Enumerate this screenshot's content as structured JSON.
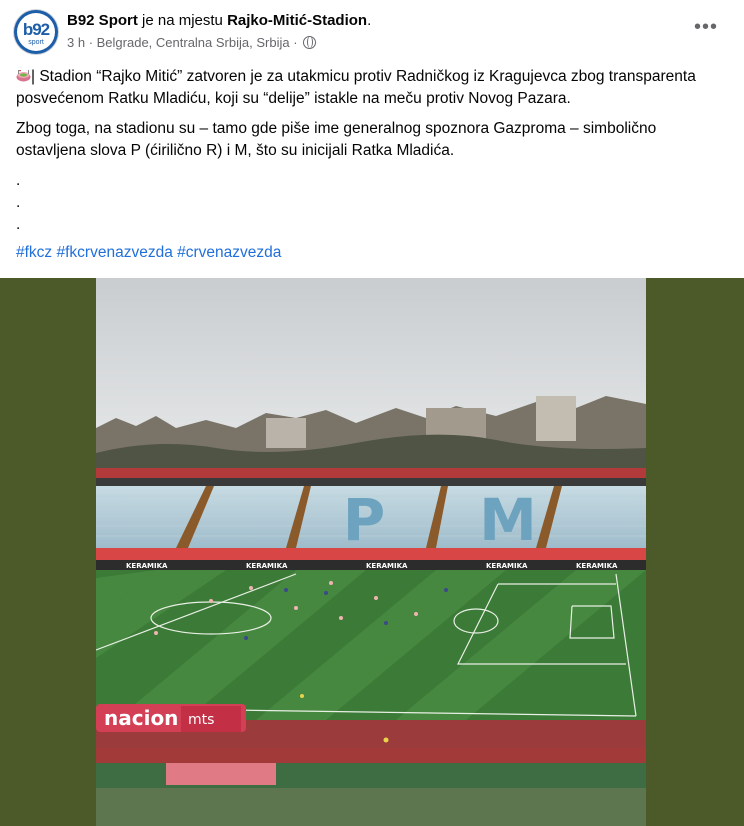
{
  "header": {
    "page_name": "B92 Sport",
    "action_text": " je na mjestu ",
    "location_name": "Rajko-Mitić-Stadion",
    "location_suffix": ".",
    "time": "3 h",
    "separator": " · ",
    "place": "Belgrade, Centralna Srbija, Srbija",
    "separator2": " · ",
    "privacy_icon": "globe-icon",
    "avatar": {
      "text": "b92",
      "subtext": "sport"
    },
    "more_label": "•••"
  },
  "post": {
    "paragraph1": "| Stadion “Rajko Mitić” zatvoren je za utakmicu protiv Radničkog iz Kragujevca zbog transparenta posvećenom Ratku Mladiću, koji su “delije” istakle na meču protiv Novog Pazara.",
    "paragraph2": "Zbog toga, na stadionu su – tamo gde piše ime generalnog spoznora Gazproma – simbolično ostavljena slova P (ćirilično R) i M, što su inicijali Ratka Mladića.",
    "dots": [
      ".",
      ".",
      "."
    ],
    "hashtags": [
      "#fkcz",
      "#fkcrvenazvezda",
      "#crvenazvezda"
    ],
    "emoji_icon": "stadium-icon"
  },
  "image": {
    "letters": [
      "P",
      "M"
    ],
    "sponsor_text": "KERAMIKA",
    "adboard_left": "nacion",
    "adboard_right": "mts",
    "background_color": "#4b5a28"
  }
}
